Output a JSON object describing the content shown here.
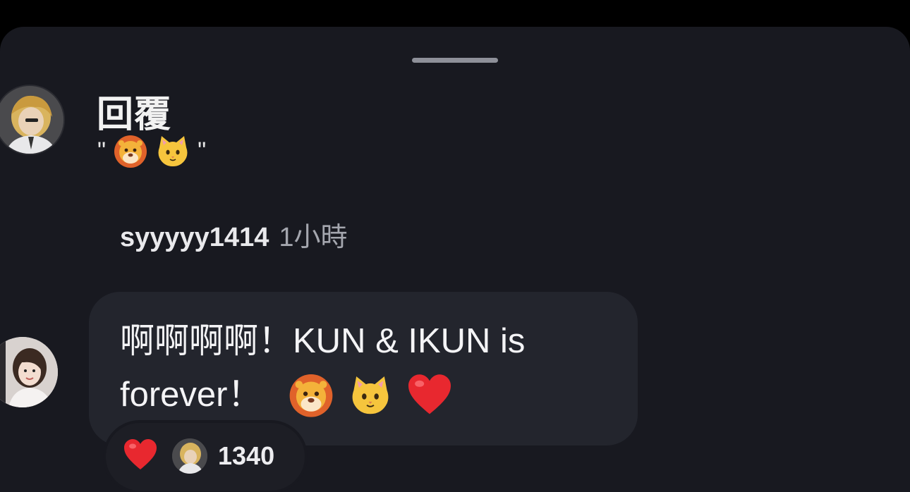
{
  "sheet": {
    "title": "回覆",
    "quote": {
      "open": "\"",
      "close": "\"",
      "emoji": [
        "lion-face-emoji",
        "cat-face-emoji"
      ]
    }
  },
  "comment": {
    "username": "syyyyy1414",
    "timestamp": "1小時",
    "text_line1": "啊啊啊啊！KUN & IKUN is",
    "text_line2": "forever！",
    "text_emoji": [
      "lion-face-emoji",
      "cat-face-emoji",
      "red-heart-emoji"
    ],
    "reactions": {
      "icon": "red-heart-emoji",
      "count": "1340"
    }
  },
  "colors": {
    "background": "#181920",
    "bubble": "#23252d",
    "text": "#f4f4f6",
    "muted": "#a4a6ae",
    "heart": "#e8282f"
  }
}
